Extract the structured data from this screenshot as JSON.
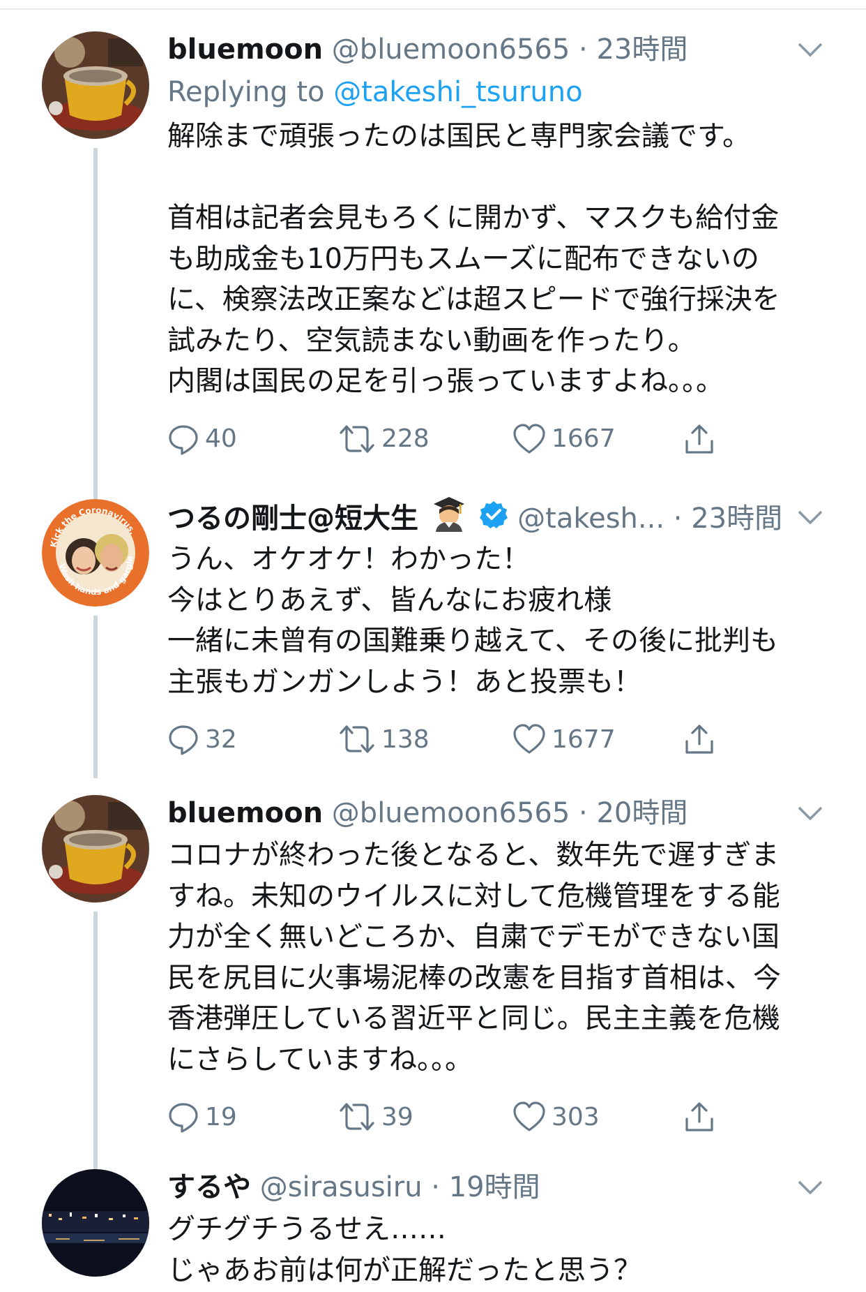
{
  "tweets": [
    {
      "name": "bluemoon",
      "handle": "@bluemoon6565",
      "time": "23時間",
      "reply_prefix": "Replying to ",
      "reply_to": "@takeshi_tsuruno",
      "text": "解除まで頑張ったのは国民と専門家会議です。\n\n首相は記者会見もろくに開かず、マスクも給付金\nも助成金も10万円もスムーズに配布できないの\nに、検察法改正案などは超スピードで強行採決を\n試みたり、空気読まない動画を作ったり。\n内閣は国民の足を引っ張っていますよね。。。",
      "replies": "40",
      "retweets": "228",
      "likes": "1667"
    },
    {
      "name": "つるの剛士@短大生",
      "handle": "@takesh...",
      "time": "23時間",
      "text": "うん、オケオケ！わかった！\n今はとりあえず、皆んなにお疲れ様\n一緒に未曾有の国難乗り越えて、その後に批判も\n主張もガンガンしよう！あと投票も！",
      "avatar_text": "Kick the Coronavirus. Wash hands and gargle",
      "replies": "32",
      "retweets": "138",
      "likes": "1677"
    },
    {
      "name": "bluemoon",
      "handle": "@bluemoon6565",
      "time": "20時間",
      "text": "コロナが終わった後となると、数年先で遅すぎま\nすね。未知のウイルスに対して危機管理をする能\n力が全く無いどころか、自粛でデモができない国\n民を尻目に火事場泥棒の改憲を目指す首相は、今\n香港弾圧している習近平と同じ。民主主義を危機\nにさらしていますね。。。",
      "replies": "19",
      "retweets": "39",
      "likes": "303"
    },
    {
      "name": "するや",
      "handle": "@sirasusiru",
      "time": "19時間",
      "text": "グチグチうるせえ……\nじゃあお前は何が正解だったと思う？"
    }
  ],
  "separator": "·",
  "colors": {
    "text": "#14171a",
    "secondary": "#657786",
    "link": "#1da1f2",
    "thread_line": "#ccd6dd",
    "avatar_ring": "#e8702a"
  }
}
